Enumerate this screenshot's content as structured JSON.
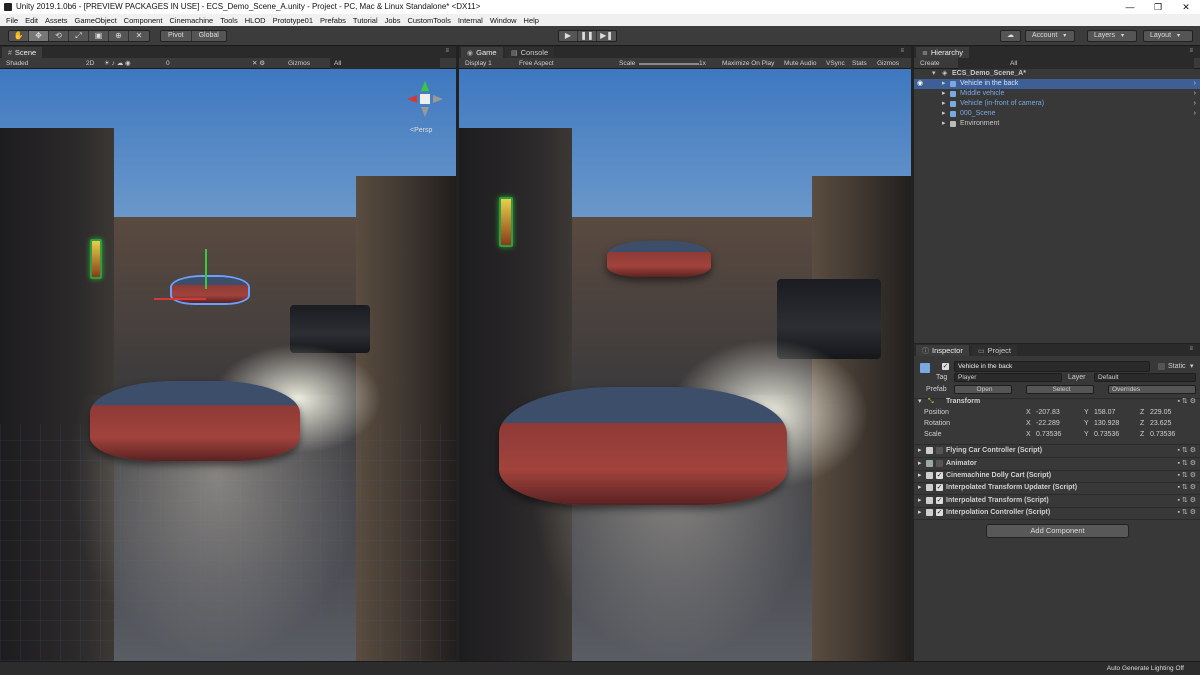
{
  "window": {
    "title": "Unity 2019.1.0b6 - [PREVIEW PACKAGES IN USE] - ECS_Demo_Scene_A.unity - Project - PC, Mac & Linux Standalone* <DX11>",
    "minimize": "—",
    "maximize": "❐",
    "close": "✕"
  },
  "menu": [
    "File",
    "Edit",
    "Assets",
    "GameObject",
    "Component",
    "Cinemachine",
    "Tools",
    "HLOD",
    "Prototype01",
    "Prefabs",
    "Tutorial",
    "Jobs",
    "CustomTools",
    "Internal",
    "Window",
    "Help"
  ],
  "toolbar": {
    "tools": [
      "✋",
      "✥",
      "⟲",
      "⤢",
      "▣",
      "⊕",
      "✕"
    ],
    "pivot": "Pivot",
    "global": "Global",
    "play": "▶",
    "pause": "❚❚",
    "step": "▶❚",
    "cloud": "☁",
    "account": "Account",
    "layers": "Layers",
    "layout": "Layout"
  },
  "scene": {
    "tab": "Scene",
    "shading": "Shaded",
    "mode2d": "2D",
    "layers_count": "0",
    "gizmos": "Gizmos",
    "search": "All",
    "persp": "<Persp"
  },
  "game": {
    "tab": "Game",
    "console_tab": "Console",
    "display": "Display 1",
    "aspect": "Free Aspect",
    "scale_label": "Scale",
    "scale_value": "1x",
    "maximize": "Maximize On Play",
    "mute": "Mute Audio",
    "vsync": "VSync",
    "stats": "Stats",
    "gizmos": "Gizmos"
  },
  "hierarchy": {
    "tab": "Hierarchy",
    "create": "Create",
    "search": "All",
    "scene": "ECS_Demo_Scene_A*",
    "items": [
      {
        "label": "Vehicle in the back",
        "selected": true
      },
      {
        "label": "Middle vehicle",
        "selected": false
      },
      {
        "label": "Vehicle (in-front of camera)",
        "selected": false
      },
      {
        "label": "000_Scene",
        "selected": false
      },
      {
        "label": "Environment",
        "selected": false
      }
    ]
  },
  "inspector": {
    "tab": "Inspector",
    "project_tab": "Project",
    "object_name": "Vehicle in the back",
    "static": "Static",
    "tag_label": "Tag",
    "tag": "Player",
    "layer_label": "Layer",
    "layer": "Default",
    "prefab_label": "Prefab",
    "open": "Open",
    "select": "Select",
    "overrides": "Overrides",
    "transform": {
      "title": "Transform",
      "rows": [
        {
          "label": "Position",
          "x": "-207.83",
          "y": "158.07",
          "z": "229.05"
        },
        {
          "label": "Rotation",
          "x": "-22.289",
          "y": "130.928",
          "z": "23.625"
        },
        {
          "label": "Scale",
          "x": "0.73536",
          "y": "0.73536",
          "z": "0.73536"
        }
      ]
    },
    "components": [
      {
        "name": "Flying Car Controller (Script)",
        "checked": false
      },
      {
        "name": "Animator",
        "checked": false
      },
      {
        "name": "Cinemachine Dolly Cart (Script)",
        "checked": true
      },
      {
        "name": "Interpolated Transform Updater (Script)",
        "checked": true
      },
      {
        "name": "Interpolated Transform (Script)",
        "checked": true
      },
      {
        "name": "Interpolation Controller (Script)",
        "checked": true
      }
    ],
    "add_component": "Add Component"
  },
  "status": {
    "text": "Auto Generate Lighting Off"
  }
}
